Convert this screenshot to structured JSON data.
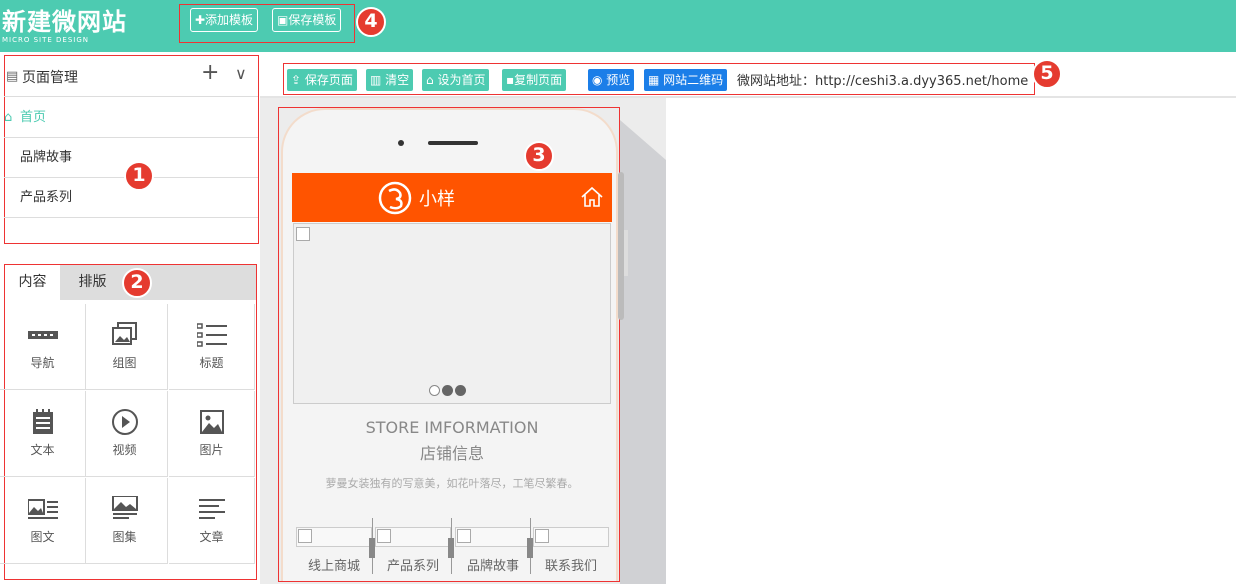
{
  "header": {
    "logo_cn": "新建微网站",
    "logo_en": "MICRO SITE DESIGN",
    "add_template": "✚添加模板",
    "save_template": "▣保存模板"
  },
  "badges": [
    "1",
    "2",
    "3",
    "4",
    "5"
  ],
  "page_manager": {
    "title": "页面管理",
    "add": "+",
    "collapse": "∨",
    "items": [
      {
        "label": "首页",
        "active": true
      },
      {
        "label": "品牌故事",
        "active": false
      },
      {
        "label": "产品系列",
        "active": false
      }
    ]
  },
  "components": {
    "tabs": [
      "内容",
      "排版"
    ],
    "items": [
      {
        "label": "导航",
        "icon": "navigation-icon"
      },
      {
        "label": "组图",
        "icon": "gallery-icon"
      },
      {
        "label": "标题",
        "icon": "list-icon"
      },
      {
        "label": "文本",
        "icon": "notepad-icon"
      },
      {
        "label": "视频",
        "icon": "play-icon"
      },
      {
        "label": "图片",
        "icon": "image-icon"
      },
      {
        "label": "图文",
        "icon": "image-text-icon"
      },
      {
        "label": "图集",
        "icon": "album-icon"
      },
      {
        "label": "文章",
        "icon": "article-icon"
      }
    ]
  },
  "toolbar": {
    "save_page": "保存页面",
    "clear": "清空",
    "set_home": "设为首页",
    "copy_page": "复制页面",
    "preview": "预览",
    "qrcode": "网站二维码",
    "site_url_label": "微网站地址：http://ceshi3.a.dyy365.net/home"
  },
  "phone": {
    "shop_name": "小样",
    "store_en": "STORE IMFORMATION",
    "store_cn": "店铺信息",
    "store_desc": "萝曼女装独有的写意美，如花叶落尽，工笔尽繁春。",
    "nav": [
      "线上商城",
      "产品系列",
      "品牌故事",
      "联系我们"
    ]
  },
  "colors": {
    "brand": "#4dcbb1",
    "accent_blue": "#1b7ee8",
    "phone_header": "#ff5400",
    "badge_red": "#e53b2f"
  }
}
